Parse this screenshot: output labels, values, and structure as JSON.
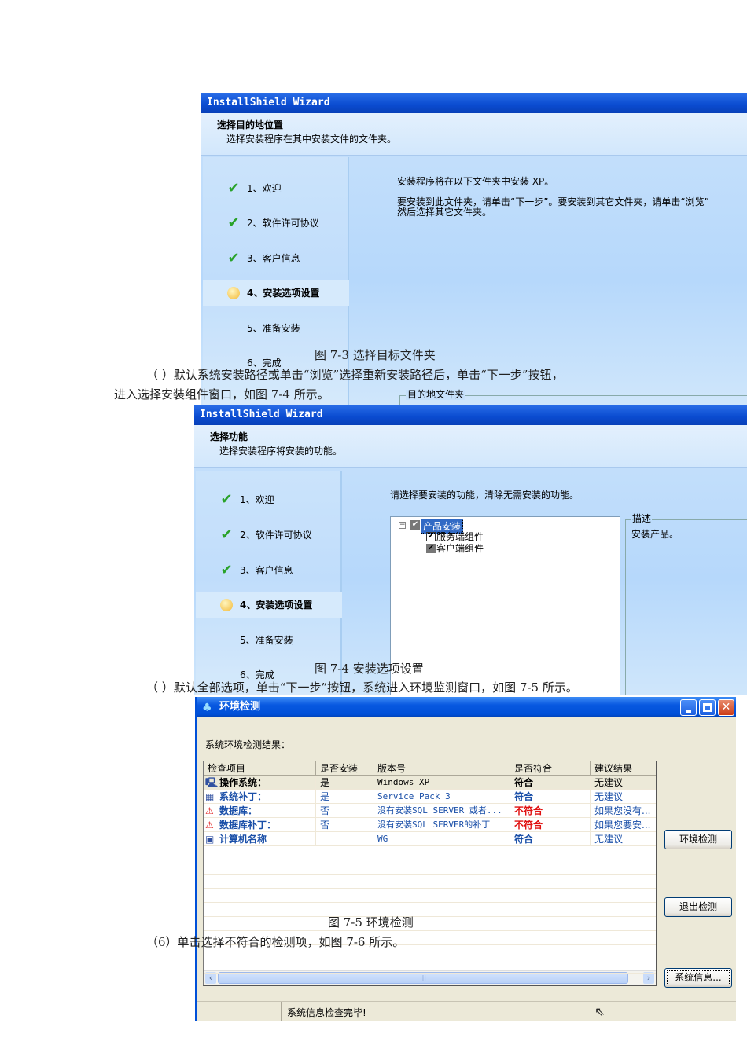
{
  "fig73": {
    "title": "InstallShield Wizard",
    "header_title": "选择目的地位置",
    "header_sub": "选择安装程序在其中安装文件的文件夹。",
    "steps": [
      "1、欢迎",
      "2、软件许可协议",
      "3、客户信息",
      "4、安装选项设置",
      "5、准备安装",
      "6、完成"
    ],
    "line1": "安装程序将在以下文件夹中安装 XP。",
    "line2": "要安装到此文件夹，请单击“下一步”。要安装到其它文件夹，请单击“浏览”",
    "line3": "然后选择其它文件夹。",
    "group_label": "目的地文件夹",
    "caption": "图 7-3  选择目标文件夹"
  },
  "para1": {
    "line1": "（ ）默认系统安装路径或单击“浏览”选择重新安装路径后，单击“下一步”按钮，",
    "line2": "进入选择安装组件窗口，如图 7-4 所示。"
  },
  "fig74": {
    "title": "InstallShield Wizard",
    "header_title": "选择功能",
    "header_sub": "选择安装程序将安装的功能。",
    "steps": [
      "1、欢迎",
      "2、软件许可协议",
      "3、客户信息",
      "4、安装选项设置",
      "5、准备安装",
      "6、完成"
    ],
    "instruction": "请选择要安装的功能，清除无需安装的功能。",
    "tree": {
      "root": "产品安装",
      "children": [
        "服务端组件",
        "客户端组件"
      ]
    },
    "desc_label": "描述",
    "desc_text": "安装产品。",
    "caption": "图 7-4  安装选项设置"
  },
  "para2": "（ ）默认全部选项，单击“下一步”按钮，系统进入环境监测窗口，如图 7-5 所示。",
  "fig75": {
    "title": "环境检测",
    "result_label": "系统环境检测结果：",
    "columns": [
      "检查项目",
      "是否安装",
      "版本号",
      "是否符合",
      "建议结果"
    ],
    "rows": [
      {
        "item": "操作系统：",
        "installed": "是",
        "version": "Windows XP",
        "ok": "符合",
        "advice": "无建议",
        "icon": "computer-icon",
        "status": "pass"
      },
      {
        "item": "系统补丁：",
        "installed": "是",
        "version": "Service Pack 3",
        "ok": "符合",
        "advice": "无建议",
        "icon": "patch-icon",
        "status": "pass"
      },
      {
        "item": "数据库：",
        "installed": "否",
        "version": "没有安装SQL SERVER 或者...",
        "ok": "不符合",
        "advice": "如果您没有...",
        "icon": "alarm-icon",
        "status": "fail"
      },
      {
        "item": "数据库补丁：",
        "installed": "否",
        "version": "没有安装SQL SERVER的补丁",
        "ok": "不符合",
        "advice": "如果您要安...",
        "icon": "alarm-icon",
        "status": "fail"
      },
      {
        "item": "计算机名称",
        "installed": "",
        "version": "WG",
        "ok": "符合",
        "advice": "无建议",
        "icon": "monitor-icon",
        "status": "pass"
      }
    ],
    "buttons": {
      "check": "环境检测",
      "exit": "退出检测",
      "sysinfo": "系统信息..."
    },
    "status": "系统信息检查完毕!",
    "caption": "图 7-5  环境检测",
    "colors": {
      "pass": "#1a4fa8",
      "fail": "#e01010"
    }
  },
  "para3": "（6）单击选择不符合的检测项，如图 7-6 所示。"
}
